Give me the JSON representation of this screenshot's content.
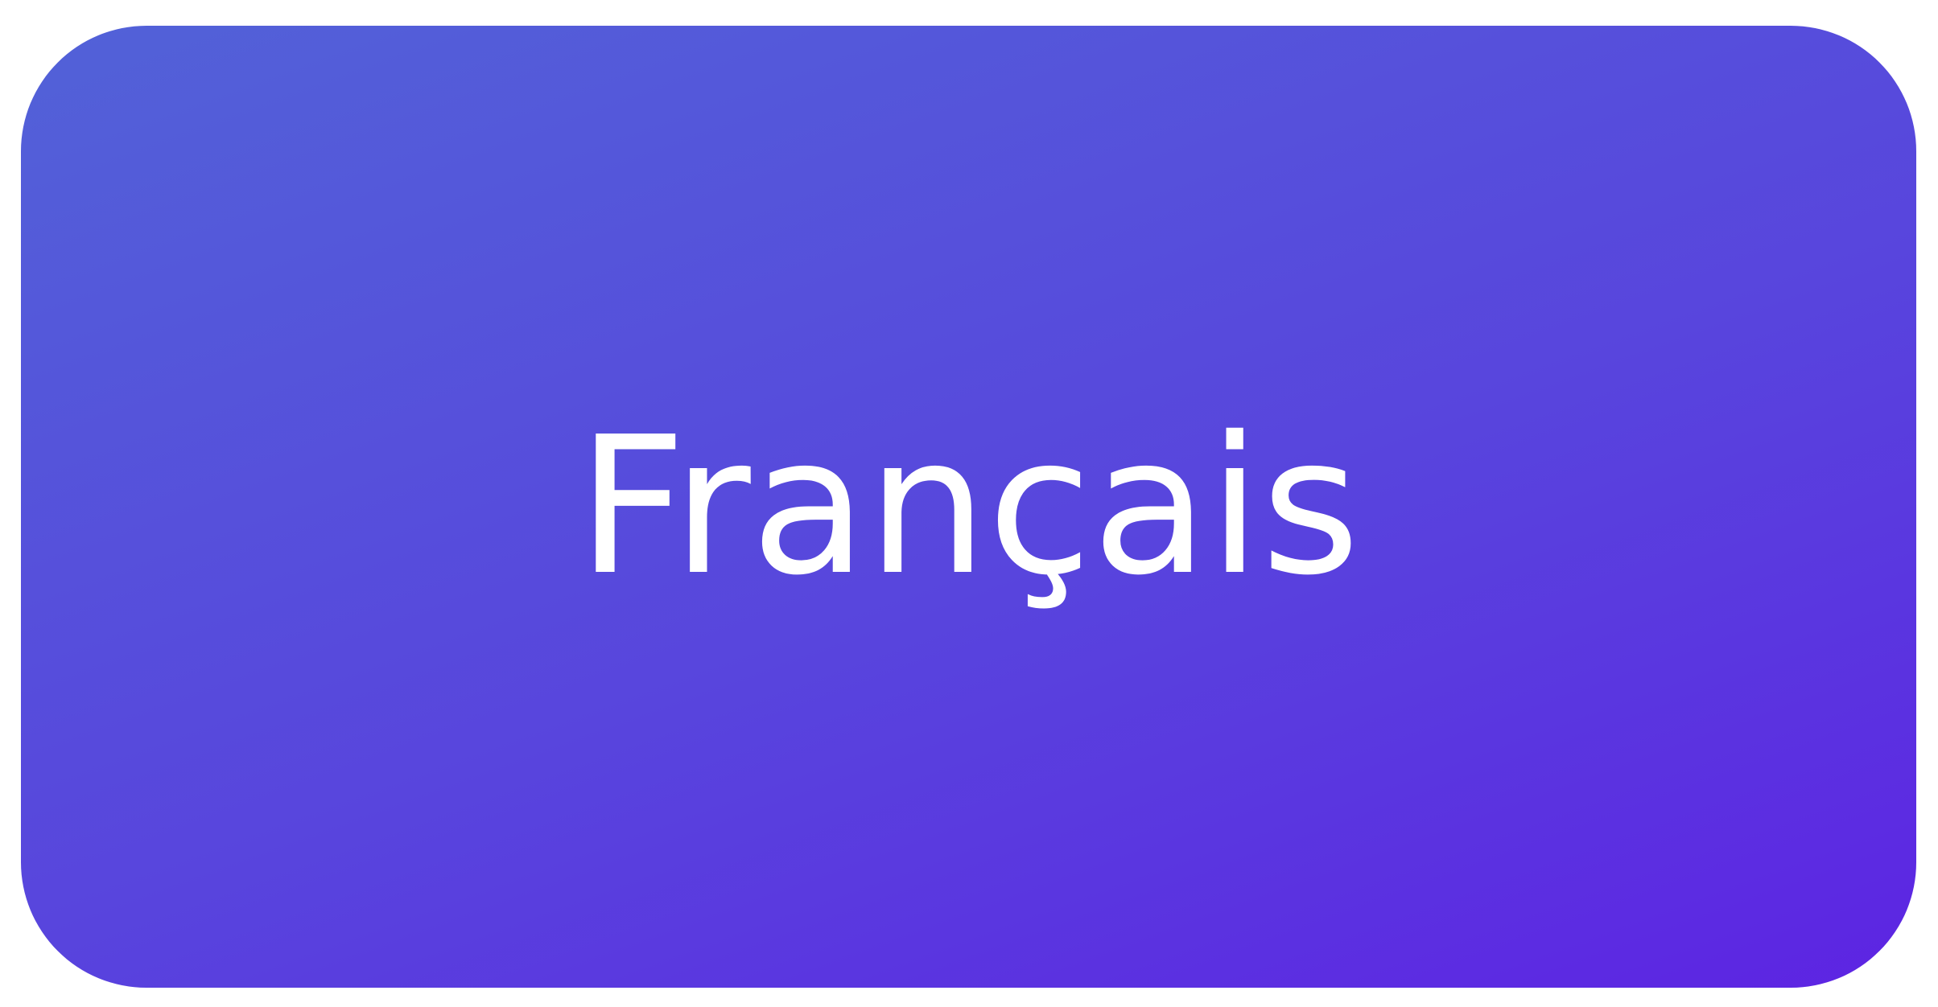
{
  "language_button": {
    "label": "Français"
  },
  "colors": {
    "gradient_start": "#5262d8",
    "gradient_middle": "#5845dd",
    "gradient_end": "#5d24e3",
    "label_text": "#ffffff",
    "page_background": "#ffffff"
  }
}
